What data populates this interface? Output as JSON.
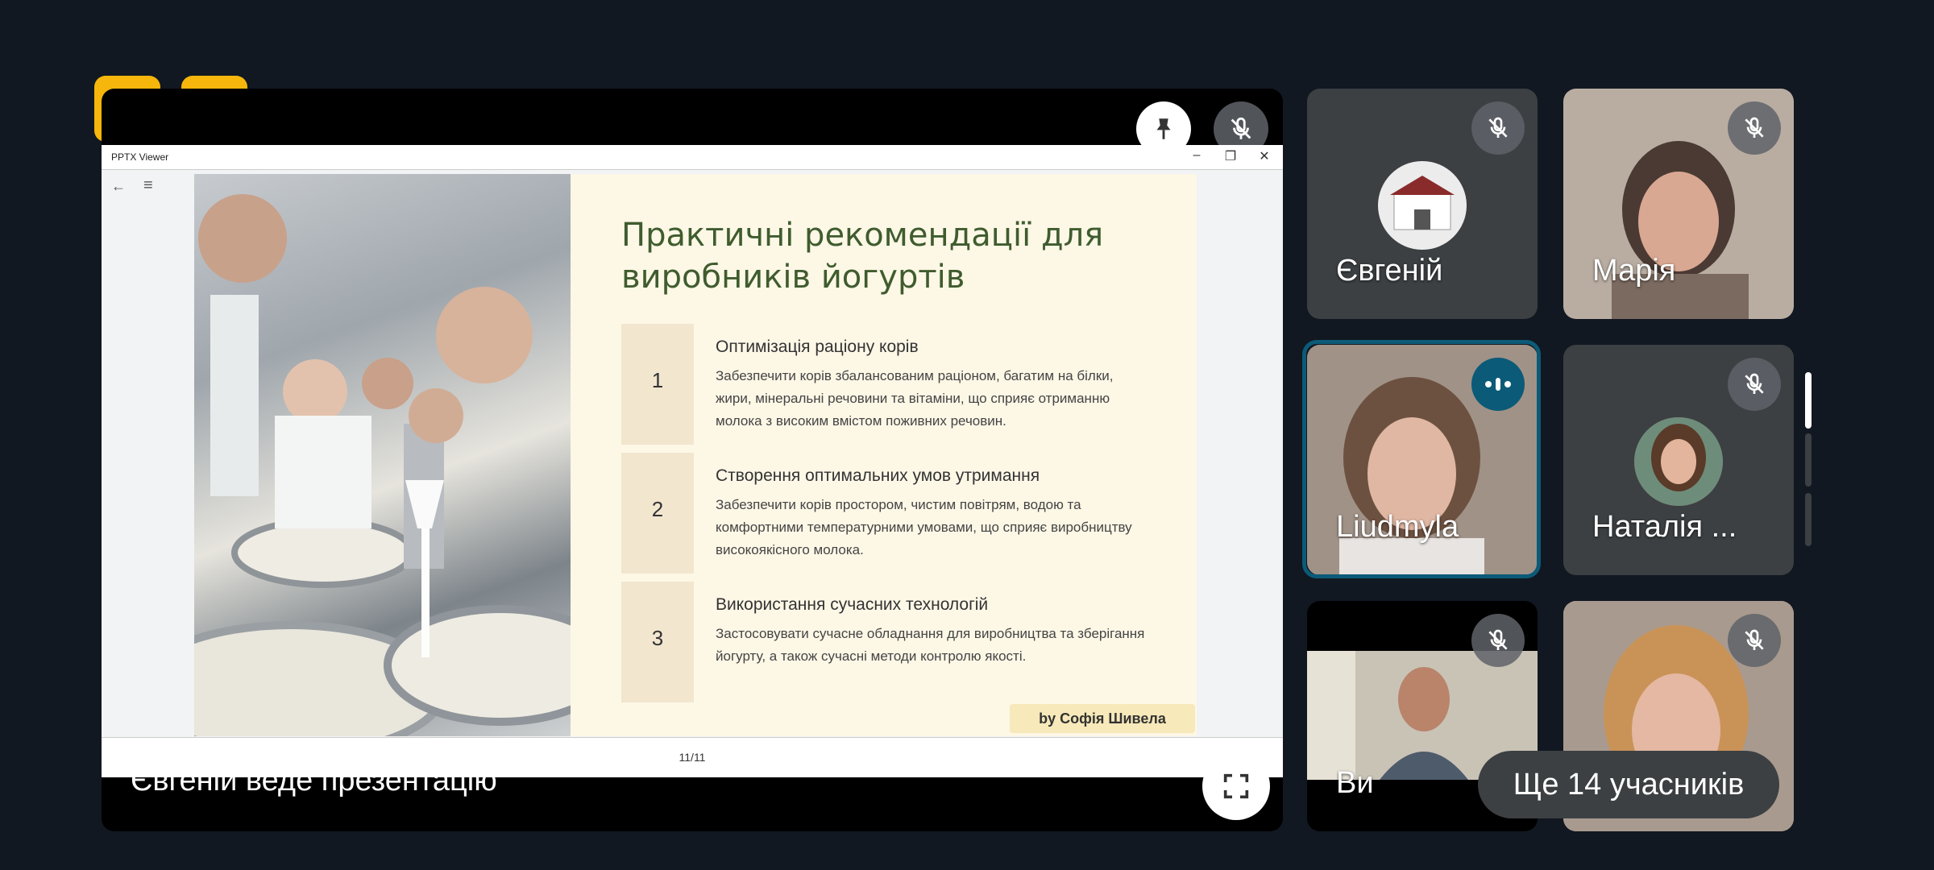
{
  "badges": [
    {
      "icon": "no-building-icon"
    },
    {
      "icon": "door-icon"
    }
  ],
  "stage": {
    "presenting_label": "Євгеній веде презентацію",
    "viewer": {
      "app_title": "PPTX Viewer",
      "page_indicator": "11/11"
    },
    "slide": {
      "title": "Практичні рекомендації для виробників йогуртів",
      "items": [
        {
          "num": "1",
          "heading": "Оптимізація раціону корів",
          "body": "Забезпечити корів збалансованим раціоном, багатим на білки, жири, мінеральні речовини та вітаміни, що сприяє отриманню молока з високим вмістом поживних речовин."
        },
        {
          "num": "2",
          "heading": "Створення оптимальних умов утримання",
          "body": "Забезпечити корів простором, чистим повітрям, водою та комфортними температурними умовами, що сприяє виробництву високоякісного молока."
        },
        {
          "num": "3",
          "heading": "Використання сучасних технологій",
          "body": "Застосовувати сучасне обладнання для виробництва та зберігання йогурту, а також сучасні методи контролю якості."
        }
      ],
      "author": "by Софія Шивела"
    }
  },
  "participants": [
    {
      "name": "Євгеній",
      "muted": true
    },
    {
      "name": "Марія",
      "muted": true
    },
    {
      "name": "Liudmyla",
      "muted": false,
      "speaking": true
    },
    {
      "name": "Наталія ...",
      "muted": true
    },
    {
      "name": "Ви",
      "muted": true
    },
    {
      "name": "",
      "muted": true
    }
  ],
  "more_participants": "Ще 14 учасників",
  "colors": {
    "accent": "#f6b60b",
    "speaking": "#0b5a78",
    "tile": "#3c4043",
    "background": "#111821"
  }
}
